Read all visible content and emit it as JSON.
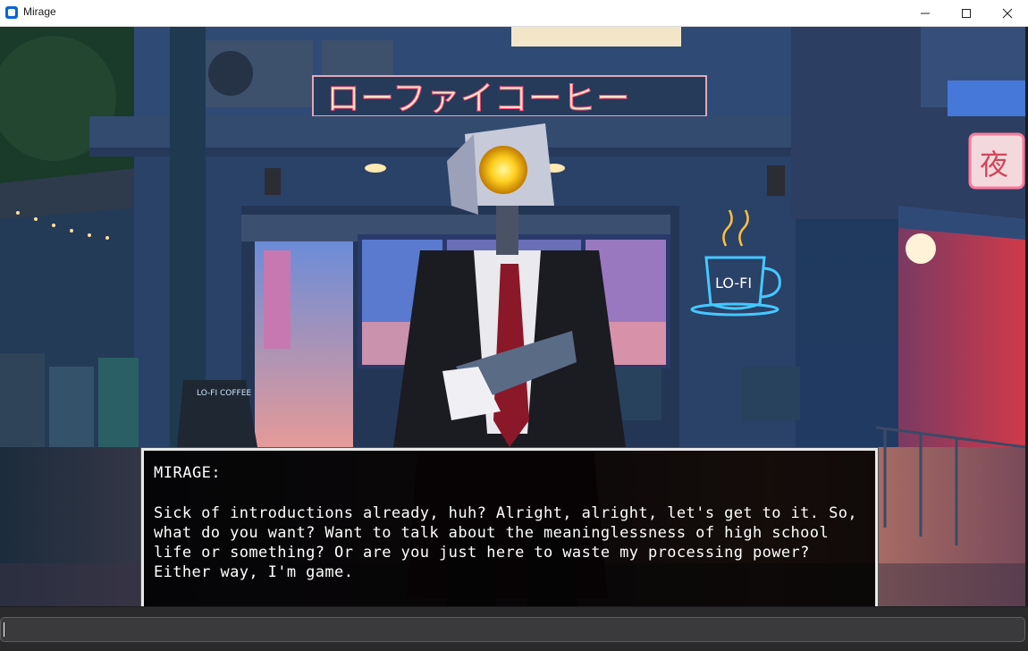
{
  "window": {
    "title": "Mirage"
  },
  "scene": {
    "shop_sign": "ローファイコーヒー",
    "night_sign": "夜",
    "neon_cup_label": "LO-FI",
    "board_label": "LO-FI COFFEE"
  },
  "dialog": {
    "speaker": "MIRAGE:",
    "text": "Sick of introductions already, huh? Alright, alright, let's get to it. So, what do you want? Want to talk about the meaninglessness of high school life or something? Or are you just here to waste my processing power? Either way, I'm game."
  },
  "input": {
    "value": "",
    "placeholder": ""
  }
}
